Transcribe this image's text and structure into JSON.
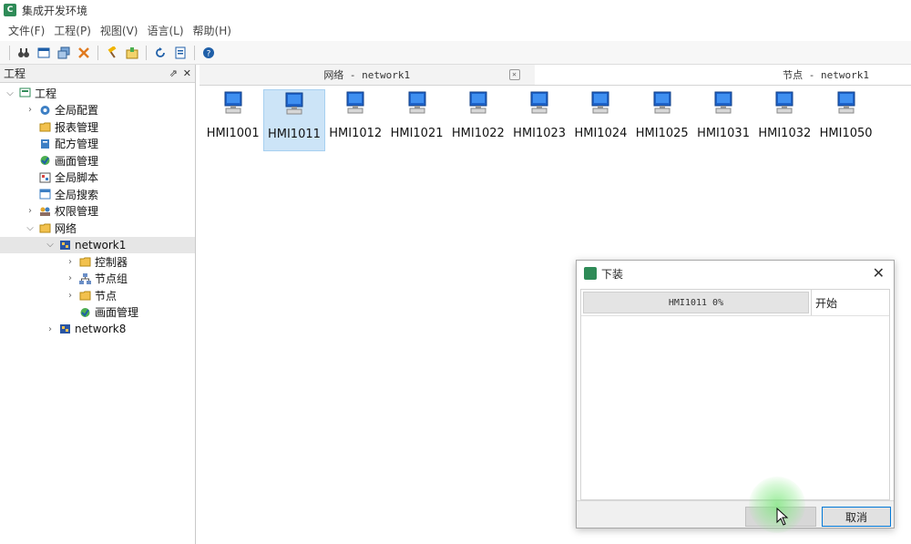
{
  "window": {
    "title": "集成开发环境"
  },
  "menu": [
    "文件(F)",
    "工程(P)",
    "视图(V)",
    "语言(L)",
    "帮助(H)"
  ],
  "toolbar": {
    "icons": [
      "binoculars-icon",
      "window-icon",
      "stack-icon",
      "delete-icon",
      "hammer-icon",
      "build-icon",
      "refresh-icon",
      "download-icon",
      "help-icon"
    ]
  },
  "project_panel": {
    "title": "工程",
    "ctrls": [
      "⇗",
      "✕"
    ],
    "tree": [
      {
        "label": "工程",
        "depth": 0,
        "expanded": true,
        "icon": "project-icon"
      },
      {
        "label": "全局配置",
        "depth": 1,
        "expanded": false,
        "icon": "gear-icon"
      },
      {
        "label": "报表管理",
        "depth": 1,
        "icon": "folder-icon"
      },
      {
        "label": "配方管理",
        "depth": 1,
        "icon": "recipe-icon"
      },
      {
        "label": "画面管理",
        "depth": 1,
        "icon": "screen-icon"
      },
      {
        "label": "全局脚本",
        "depth": 1,
        "icon": "script-icon"
      },
      {
        "label": "全局搜索",
        "depth": 1,
        "icon": "search-icon"
      },
      {
        "label": "权限管理",
        "depth": 1,
        "expanded": false,
        "icon": "users-icon"
      },
      {
        "label": "网络",
        "depth": 1,
        "expanded": true,
        "icon": "folder-icon"
      },
      {
        "label": "network1",
        "depth": 2,
        "expanded": true,
        "icon": "network-icon",
        "selected": true
      },
      {
        "label": "控制器",
        "depth": 3,
        "expanded": false,
        "icon": "folder-icon"
      },
      {
        "label": "节点组",
        "depth": 3,
        "expanded": false,
        "icon": "nodegroup-icon"
      },
      {
        "label": "节点",
        "depth": 3,
        "expanded": false,
        "icon": "folder-icon"
      },
      {
        "label": "画面管理",
        "depth": 3,
        "icon": "screen-icon"
      },
      {
        "label": "network8",
        "depth": 2,
        "expanded": false,
        "icon": "network-icon"
      }
    ]
  },
  "tabs": [
    {
      "label": "网络 - network1",
      "active": false
    },
    {
      "label": "节点 - network1",
      "active": true
    }
  ],
  "nodes": [
    {
      "name": "HMI1001",
      "selected": false
    },
    {
      "name": "HMI1011",
      "selected": true
    },
    {
      "name": "HMI1012",
      "selected": false
    },
    {
      "name": "HMI1021",
      "selected": false
    },
    {
      "name": "HMI1022",
      "selected": false
    },
    {
      "name": "HMI1023",
      "selected": false
    },
    {
      "name": "HMI1024",
      "selected": false
    },
    {
      "name": "HMI1025",
      "selected": false
    },
    {
      "name": "HMI1031",
      "selected": false
    },
    {
      "name": "HMI1032",
      "selected": false
    },
    {
      "name": "HMI1050",
      "selected": false
    }
  ],
  "dialog": {
    "title": "下装",
    "rows": [
      {
        "progress_text": "HMI1011  0%",
        "progress": 0,
        "status": "开始"
      }
    ],
    "ok_label": "",
    "cancel_label": "取消"
  }
}
